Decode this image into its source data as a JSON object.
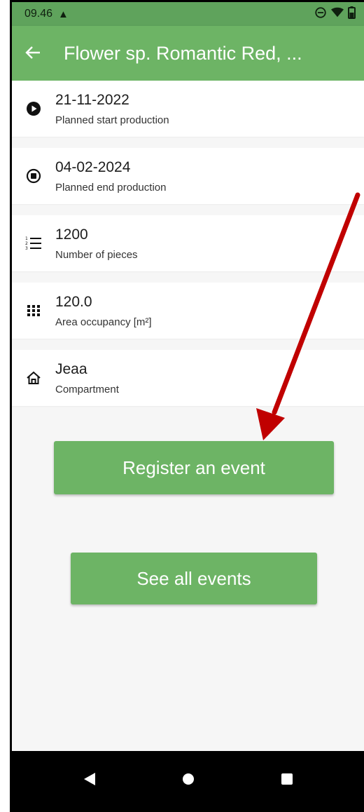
{
  "status_bar": {
    "time": "09.46",
    "alert": "▲"
  },
  "app_bar": {
    "title": "Flower sp. Romantic Red, ..."
  },
  "items": [
    {
      "value": "21-11-2022",
      "label": "Planned start production",
      "icon": "play-circle-icon"
    },
    {
      "value": "04-02-2024",
      "label": "Planned end production",
      "icon": "stop-circle-icon"
    },
    {
      "value": "1200",
      "label": "Number of pieces",
      "icon": "numbered-list-icon"
    },
    {
      "value": "120.0",
      "label": "Area occupancy [m²]",
      "icon": "grid-icon"
    },
    {
      "value": "Jeaa",
      "label": "Compartment",
      "icon": "home-icon"
    }
  ],
  "buttons": {
    "register": "Register an event",
    "see_all": "See all events"
  },
  "colors": {
    "primary": "#6db465",
    "status": "#5fa35c",
    "arrow": "#c00000"
  }
}
